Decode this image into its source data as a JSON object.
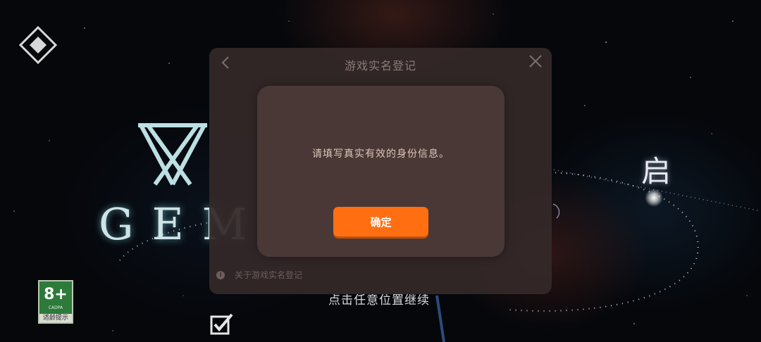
{
  "scene": {
    "logo_text": "GEM",
    "start_char": "启",
    "continue_prompt": "点击任意位置继续"
  },
  "age_badge": {
    "age": "8+",
    "org": "CADPA",
    "tip": "适龄提示",
    "color": "#2d7a3a"
  },
  "dialog": {
    "title": "游戏实名登记",
    "about_label": "关于游戏实名登记",
    "back_icon": "chevron-left-icon",
    "close_icon": "close-icon"
  },
  "alert": {
    "message": "请填写真实有效的身份信息。",
    "confirm_label": "确定",
    "accent_color": "#ff6f12"
  }
}
